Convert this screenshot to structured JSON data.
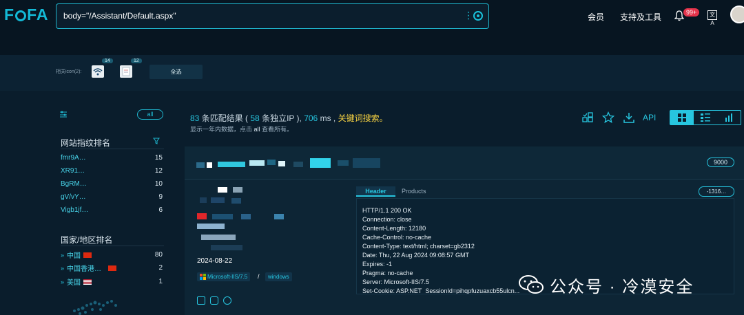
{
  "header": {
    "logo": "FOFA",
    "search_query": "body=\"/Assistant/Default.aspx\"",
    "nav": [
      "会员",
      "支持及工具"
    ],
    "notification_badge": "99+",
    "translate_icon": "文A"
  },
  "icon_filter": {
    "label": "相关icon(2):",
    "icons": [
      {
        "name": "wifi-icon",
        "count": "14"
      },
      {
        "name": "document-icon",
        "count": "12"
      }
    ],
    "select_all": "全选"
  },
  "sidebar": {
    "all_label": "all",
    "fingerprint_title": "网站指纹排名",
    "fingerprints": [
      {
        "name": "fmr9A…",
        "count": "15"
      },
      {
        "name": "XR91…",
        "count": "12"
      },
      {
        "name": "BgRM…",
        "count": "10"
      },
      {
        "name": "gV/vY…",
        "count": "9"
      },
      {
        "name": "Vigb1jf…",
        "count": "6"
      }
    ],
    "country_title": "国家/地区排名",
    "countries": [
      {
        "name": "中国",
        "count": "80"
      },
      {
        "name": "中国香港…",
        "count": "2"
      },
      {
        "name": "美国",
        "count": "1"
      }
    ]
  },
  "results": {
    "count": "83",
    "count_suffix": " 条匹配结果 (",
    "ip_count": "58",
    "ip_suffix": " 条独立IP ),",
    "ms": "706",
    "ms_suffix": " ms ,",
    "keyword_link": "关键词搜索。",
    "note_prefix": "显示一年内数据，点击 ",
    "note_all": "all",
    "note_suffix": " 查看所有。",
    "api_label": "API"
  },
  "result_card": {
    "port": "9000",
    "date": "2024-08-22",
    "server_tag": "Microsoft-IIS/7.5",
    "os_tag": "windows",
    "tab_header": "Header",
    "tab_products": "Products",
    "hash_label": "-1316…",
    "header_lines": [
      "HTTP/1.1 200 OK",
      "Connection: close",
      "Content-Length: 12180",
      "Cache-Control: no-cache",
      "Content-Type: text/html; charset=gb2312",
      "Date: Thu, 22 Aug 2024 09:08:57 GMT",
      "Expires: -1",
      "Pragma: no-cache",
      "Server: Microsoft-IIS/7.5",
      "Set-Cookie: ASP.NET_SessionId=pihqpfuzuaxcb55ulcn..."
    ]
  },
  "watermark": "公众号 · 冷漠安全",
  "colors": {
    "accent": "#27c6e0",
    "keyword": "#f5d142",
    "background": "#0a1d2c"
  }
}
